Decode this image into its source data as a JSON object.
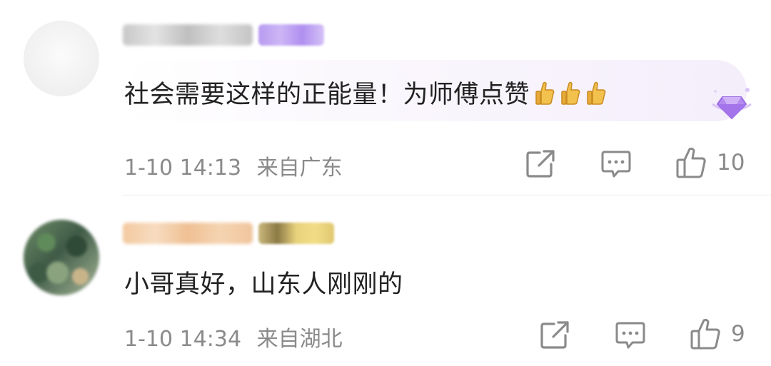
{
  "comments": [
    {
      "comment_text": "社会需要这样的正能量！为师傅点赞",
      "emoji": [
        "thumbs-up-icon",
        "thumbs-up-icon",
        "thumbs-up-icon"
      ],
      "timestamp": "1-10 14:13",
      "location": "来自广东",
      "like_count": "10",
      "username_color": "#cfcfcf",
      "badge_color": "#b99cf0"
    },
    {
      "comment_text": "小哥真好，山东人刚刚的",
      "timestamp": "1-10 14:34",
      "location": "来自湖北",
      "like_count": "9",
      "username_color": "#f3c9a0",
      "badge_color": "#d9c37a"
    }
  ],
  "icons": {
    "share": "share-icon",
    "reply": "comment-icon",
    "like": "like-icon",
    "vip": "diamond-icon"
  },
  "colors": {
    "text": "#222222",
    "meta": "#8a8a8a",
    "divider": "#ececec",
    "bubble_accent": "#f4eefb"
  }
}
